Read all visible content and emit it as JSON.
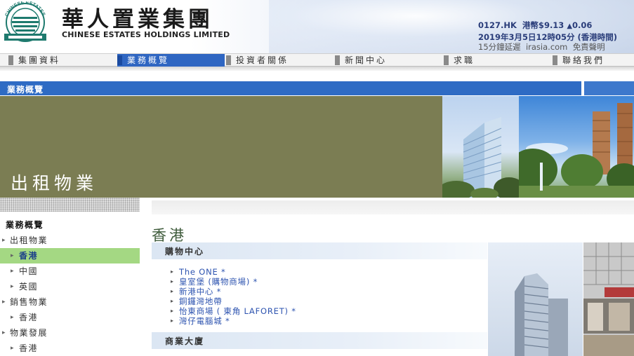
{
  "header": {
    "brand_cn": "華人置業集團",
    "brand_en": "CHINESE ESTATES HOLDINGS LIMITED",
    "logo_text": "CHINESE ESTATES",
    "stock": {
      "code": "0127.HK",
      "price_label": "港幣$9.13",
      "change": "0.06",
      "datetime": "2019年3月5日12時05分 (香港時間)",
      "delay_note": "15分鐘延遲",
      "provider": "irasia.com",
      "disclaimer": "免責聲明"
    }
  },
  "nav": {
    "items": [
      {
        "label": "集團資料"
      },
      {
        "label": "業務概覽"
      },
      {
        "label": "投資者關係"
      },
      {
        "label": "新聞中心"
      },
      {
        "label": "求職"
      },
      {
        "label": "聯絡我們"
      }
    ]
  },
  "section": {
    "title": "業務概覽"
  },
  "banner": {
    "title": "出租物業"
  },
  "sidebar": {
    "items": [
      {
        "label": "業務概覽"
      },
      {
        "label": "出租物業"
      },
      {
        "label": "香港"
      },
      {
        "label": "中國"
      },
      {
        "label": "英國"
      },
      {
        "label": "銷售物業"
      },
      {
        "label": "香港"
      },
      {
        "label": "物業發展"
      },
      {
        "label": "香港"
      }
    ]
  },
  "main": {
    "region": "香港",
    "categories": [
      {
        "label": "購物中心"
      },
      {
        "label": "商業大廈"
      }
    ],
    "shopping_list": [
      {
        "label": "The ONE *"
      },
      {
        "label": "皇室堡 (購物商場) *"
      },
      {
        "label": "新港中心 *"
      },
      {
        "label": "銅鑼灣地帶"
      },
      {
        "label": "怡東商場 ( 東角 LAFORET) *"
      },
      {
        "label": "灣仔電腦城 *"
      }
    ]
  },
  "colors": {
    "nav_active": "#2f66c2",
    "section_bar": "#2e6bc4",
    "banner_olive": "#7b7d53",
    "side_active": "#a4d883",
    "link": "#2e54b0"
  }
}
